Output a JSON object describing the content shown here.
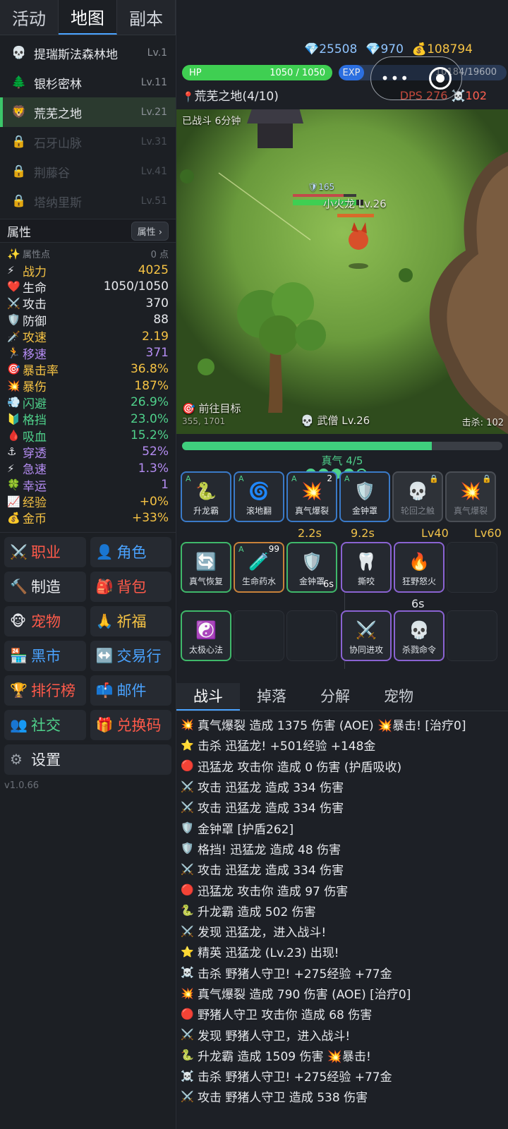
{
  "tabs": [
    "活动",
    "地图",
    "副本"
  ],
  "maps": [
    {
      "icon": "💀",
      "name": "提瑞斯法森林地",
      "lv": "Lv.1",
      "state": "normal"
    },
    {
      "icon": "🌲",
      "name": "银杉密林",
      "lv": "Lv.11",
      "state": "normal"
    },
    {
      "icon": "🦁",
      "name": "荒芜之地",
      "lv": "Lv.21",
      "state": "active"
    },
    {
      "icon": "🔒",
      "name": "石牙山脉",
      "lv": "Lv.31",
      "state": "locked"
    },
    {
      "icon": "🔒",
      "name": "荆藤谷",
      "lv": "Lv.41",
      "state": "locked"
    },
    {
      "icon": "🔒",
      "name": "塔纳里斯",
      "lv": "Lv.51",
      "state": "locked"
    }
  ],
  "attr_title": "属性",
  "attr_button": "属性 ›",
  "attr_points_label": "属性点",
  "attr_points_value": "0 点",
  "attrs": [
    {
      "icon": "⚡",
      "k": "战力",
      "v": "4025",
      "kc": "#f6c344",
      "vc": "#f6c344"
    },
    {
      "icon": "❤️",
      "k": "生命",
      "v": "1050/1050",
      "kc": "#e6e8ec",
      "vc": "#e6e8ec"
    },
    {
      "icon": "⚔️",
      "k": "攻击",
      "v": "370",
      "kc": "#e6e8ec",
      "vc": "#e6e8ec"
    },
    {
      "icon": "🛡️",
      "k": "防御",
      "v": "88",
      "kc": "#e6e8ec",
      "vc": "#e6e8ec"
    },
    {
      "icon": "🗡️",
      "k": "攻速",
      "v": "2.19",
      "kc": "#f6c344",
      "vc": "#f6c344"
    },
    {
      "icon": "🏃",
      "k": "移速",
      "v": "371",
      "kc": "#b48cf2",
      "vc": "#b48cf2"
    },
    {
      "icon": "🎯",
      "k": "暴击率",
      "v": "36.8%",
      "kc": "#f6c344",
      "vc": "#f6c344"
    },
    {
      "icon": "💥",
      "k": "暴伤",
      "v": "187%",
      "kc": "#f6c344",
      "vc": "#f6c344"
    },
    {
      "icon": "💨",
      "k": "闪避",
      "v": "26.9%",
      "kc": "#4fd18b",
      "vc": "#4fd18b"
    },
    {
      "icon": "🔰",
      "k": "格挡",
      "v": "23.0%",
      "kc": "#4fd18b",
      "vc": "#4fd18b"
    },
    {
      "icon": "🩸",
      "k": "吸血",
      "v": "15.2%",
      "kc": "#4fd18b",
      "vc": "#4fd18b"
    },
    {
      "icon": "⚓",
      "k": "穿透",
      "v": "52%",
      "kc": "#b48cf2",
      "vc": "#b48cf2"
    },
    {
      "icon": "⚡",
      "k": "急速",
      "v": "1.3%",
      "kc": "#b48cf2",
      "vc": "#b48cf2"
    },
    {
      "icon": "🍀",
      "k": "幸运",
      "v": "1",
      "kc": "#b48cf2",
      "vc": "#b48cf2"
    },
    {
      "icon": "📈",
      "k": "经验",
      "v": "+0%",
      "kc": "#f6c344",
      "vc": "#f6c344"
    },
    {
      "icon": "💰",
      "k": "金币",
      "v": "+33%",
      "kc": "#f6c344",
      "vc": "#f6c344"
    }
  ],
  "menu": [
    {
      "icon": "⚔️",
      "label": "职业",
      "color": "#ff5a4a"
    },
    {
      "icon": "👤",
      "label": "角色",
      "color": "#4aa3ff"
    },
    {
      "icon": "🔨",
      "label": "制造",
      "color": "#e6e8ec"
    },
    {
      "icon": "🎒",
      "label": "背包",
      "color": "#ff5a4a"
    },
    {
      "icon": "🐵",
      "label": "宠物",
      "color": "#ff5a4a"
    },
    {
      "icon": "🙏",
      "label": "祈福",
      "color": "#f6c344"
    },
    {
      "icon": "🏪",
      "label": "黑市",
      "color": "#4aa3ff"
    },
    {
      "icon": "↔️",
      "label": "交易行",
      "color": "#4aa3ff"
    },
    {
      "icon": "🏆",
      "label": "排行榜",
      "color": "#ff5a4a"
    },
    {
      "icon": "📫",
      "label": "邮件",
      "color": "#4aa3ff"
    },
    {
      "icon": "👥",
      "label": "社交",
      "color": "#4fd18b"
    },
    {
      "icon": "🎁",
      "label": "兑换码",
      "color": "#ff5a4a"
    }
  ],
  "settings_label": "设置",
  "version": "v1.0.66",
  "res": {
    "crystal": "25508",
    "diamond": "970",
    "gold": "108794"
  },
  "hp": {
    "label": "HP",
    "text": "1050 / 1050",
    "fraction": 1.0
  },
  "exp": {
    "label": "EXP",
    "text": "10184/19600"
  },
  "stage": "荒芜之地(4/10)",
  "dps": "DPS 276 ☠️102",
  "battle_time": "已战斗 6分钟",
  "enemy": {
    "shield": "165",
    "name": "小火龙 Lv.26"
  },
  "target": {
    "label": "前往目标",
    "coords": "355, 1701"
  },
  "player": {
    "name": "武僧",
    "lv": "Lv.26"
  },
  "kills": "击杀: 102",
  "progress": 0.78,
  "qi": {
    "label": "真气 4/5",
    "filled": 4,
    "total": 5
  },
  "skills1": [
    {
      "icon": "🐍",
      "name": "升龙霸",
      "a": "A",
      "n": "",
      "style": "",
      "lock": false
    },
    {
      "icon": "🌀",
      "name": "滚地翻",
      "a": "A",
      "n": "",
      "style": "",
      "lock": false
    },
    {
      "icon": "💥",
      "name": "真气爆裂",
      "a": "A",
      "n": "2",
      "style": "",
      "lock": false
    },
    {
      "icon": "🛡️",
      "name": "金钟罩",
      "a": "A",
      "n": "",
      "style": "",
      "lock": false
    },
    {
      "icon": "💀",
      "name": "轮回之触",
      "a": "",
      "n": "",
      "style": "gray",
      "lock": true
    },
    {
      "icon": "💥",
      "name": "真气爆裂",
      "a": "",
      "n": "",
      "style": "gray",
      "lock": true
    }
  ],
  "cds1": [
    "2.2s",
    "9.2s",
    "Lv40",
    "Lv60"
  ],
  "skills2": [
    {
      "icon": "🔄",
      "name": "真气恢复",
      "a": "",
      "n": "",
      "style": "green"
    },
    {
      "icon": "🧪",
      "name": "生命药水",
      "a": "A",
      "n": "99",
      "style": "orange"
    },
    {
      "icon": "🛡️",
      "name": "金钟罩",
      "a": "",
      "n": "",
      "style": "green",
      "cd": "6s"
    }
  ],
  "skills2b": [
    {
      "icon": "🦷",
      "name": "撕咬",
      "style": "purple"
    },
    {
      "icon": "🔥",
      "name": "狂野怒火",
      "style": "purple"
    }
  ],
  "cd2": "6s",
  "skills3": [
    {
      "icon": "☯️",
      "name": "太极心法",
      "style": "green"
    }
  ],
  "skills3b": [
    {
      "icon": "⚔️",
      "name": "协同进攻",
      "style": "purple"
    },
    {
      "icon": "💀",
      "name": "杀戮命令",
      "style": "purple"
    }
  ],
  "logtabs": [
    "战斗",
    "掉落",
    "分解",
    "宠物"
  ],
  "logs": [
    {
      "icon": "💥",
      "text": "真气爆裂 造成 1375 伤害 (AOE) 💥暴击! [治疗0]"
    },
    {
      "icon": "⭐",
      "text": "击杀 迅猛龙! +501经验 +148金"
    },
    {
      "icon": "🔴",
      "text": "迅猛龙 攻击你 造成 0 伤害 (护盾吸收)"
    },
    {
      "icon": "⚔️",
      "text": "攻击 迅猛龙 造成 334 伤害"
    },
    {
      "icon": "⚔️",
      "text": "攻击 迅猛龙 造成 334 伤害"
    },
    {
      "icon": "🛡️",
      "text": "金钟罩 [护盾262]"
    },
    {
      "icon": "🛡️",
      "text": "格挡! 迅猛龙 造成 48 伤害"
    },
    {
      "icon": "⚔️",
      "text": "攻击 迅猛龙 造成 334 伤害"
    },
    {
      "icon": "🔴",
      "text": "迅猛龙 攻击你 造成 97 伤害"
    },
    {
      "icon": "🐍",
      "text": "升龙霸 造成 502 伤害"
    },
    {
      "icon": "⚔️",
      "text": "发现 迅猛龙，进入战斗!"
    },
    {
      "icon": "⭐",
      "text": "精英 迅猛龙 (Lv.23) 出现!"
    },
    {
      "icon": "☠️",
      "text": "击杀 野猪人守卫! +275经验 +77金"
    },
    {
      "icon": "💥",
      "text": "真气爆裂 造成 790 伤害 (AOE) [治疗0]"
    },
    {
      "icon": "🔴",
      "text": "野猪人守卫 攻击你 造成 68 伤害"
    },
    {
      "icon": "⚔️",
      "text": "发现 野猪人守卫，进入战斗!"
    },
    {
      "icon": "🐍",
      "text": "升龙霸 造成 1509 伤害 💥暴击!"
    },
    {
      "icon": "☠️",
      "text": "击杀 野猪人守卫! +275经验 +77金"
    },
    {
      "icon": "⚔️",
      "text": "攻击 野猪人守卫 造成 538 伤害"
    }
  ]
}
